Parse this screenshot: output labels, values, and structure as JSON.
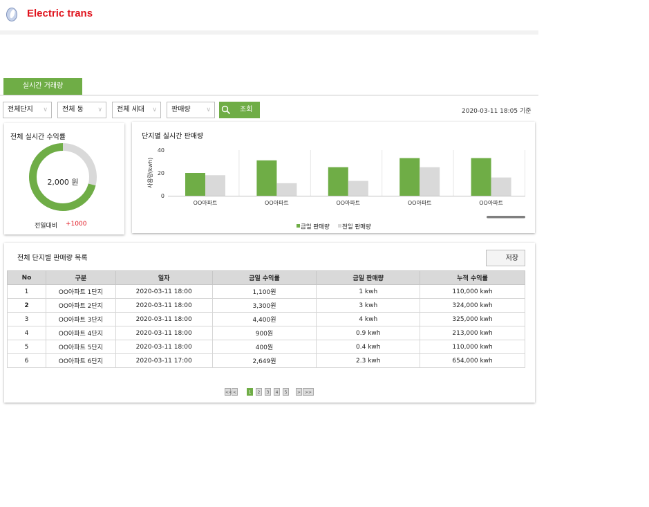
{
  "app": {
    "brand": "Electric trans",
    "accent": "#6fad46",
    "brand_color": "#e0141e"
  },
  "tab": {
    "label": "실시간 거래량"
  },
  "filters": {
    "complex": "전체단지",
    "building": "전체 동",
    "household": "전체 세대",
    "metric": "판매량",
    "search_label": "조회",
    "timestamp": "2020-03-11 18:05 기준"
  },
  "revenue_card": {
    "title": "전체 실시간 수익률",
    "center_value": "2,000 원",
    "compare_label": "전일대비",
    "compare_value": "+1000",
    "fill_fraction": 0.71
  },
  "bar_card": {
    "title": "단지별 실시간 판매량"
  },
  "chart_data": {
    "type": "bar",
    "title": "단지별 실시간 판매량",
    "ylabel": "사용량(kwh)",
    "xlabel": "",
    "ylim": [
      0,
      40
    ],
    "yticks": [
      0,
      20,
      40
    ],
    "categories": [
      "OO아파트",
      "OO아파트",
      "OO아파트",
      "OO아파트",
      "OO아파트"
    ],
    "series": [
      {
        "name": "금일 판매량",
        "color": "#6fad46",
        "values": [
          20,
          31,
          25,
          33,
          33
        ]
      },
      {
        "name": "전일 판매량",
        "color": "#d9d9d9",
        "values": [
          18,
          11,
          13,
          25,
          16
        ]
      }
    ],
    "legend": "bottom",
    "grid": false
  },
  "list_card": {
    "title": "전체 단지별 판매량 목록",
    "save_label": "저장",
    "columns": [
      "No",
      "구분",
      "일자",
      "금일 수익률",
      "금일 판매량",
      "누적 수익률"
    ],
    "rows": [
      [
        "1",
        "OO아파트 1단지",
        "2020-03-11 18:00",
        "1,100원",
        "1 kwh",
        "110,000 kwh"
      ],
      [
        "2",
        "OO아파트 2단지",
        "2020-03-11 18:00",
        "3,300원",
        "3 kwh",
        "324,000 kwh"
      ],
      [
        "3",
        "OO아파트 3단지",
        "2020-03-11 18:00",
        "4,400원",
        "4 kwh",
        "325,000 kwh"
      ],
      [
        "4",
        "OO아파트 4단지",
        "2020-03-11 18:00",
        "900원",
        "0.9 kwh",
        "213,000 kwh"
      ],
      [
        "5",
        "OO아파트 5단지",
        "2020-03-11 18:00",
        "400원",
        "0.4 kwh",
        "110,000 kwh"
      ],
      [
        "6",
        "OO아파트 6단지",
        "2020-03-11 17:00",
        "2,649원",
        "2.3 kwh",
        "654,000 kwh"
      ]
    ]
  },
  "pagination": {
    "first": "<<",
    "prev": "<",
    "pages": [
      "1",
      "2",
      "3",
      "4",
      "5"
    ],
    "active": "1",
    "next": ">",
    "last": ">>"
  }
}
